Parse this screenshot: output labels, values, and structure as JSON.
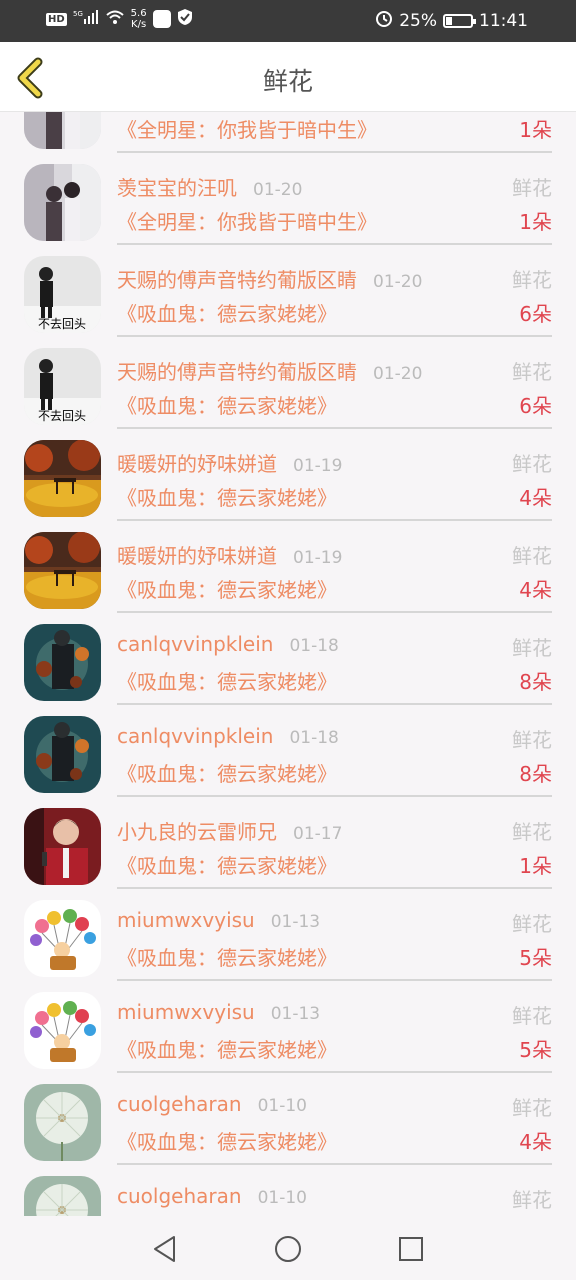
{
  "status": {
    "speed_top": "5.6",
    "speed_bottom": "K/s",
    "battery": "25%",
    "time": "11:41",
    "network": "5G"
  },
  "header": {
    "title": "鲜花"
  },
  "rows": [
    {
      "name": "",
      "date": "",
      "kind": "",
      "book": "《全明星：你我皆于暗中生》",
      "count": "1朵",
      "avatar": "couple"
    },
    {
      "name": "羡宝宝的汪叽",
      "date": "01-20",
      "kind": "鲜花",
      "book": "《全明星：你我皆于暗中生》",
      "count": "1朵",
      "avatar": "couple"
    },
    {
      "name": "天赐的傅声音特约葡版区睛",
      "date": "01-20",
      "kind": "鲜花",
      "book": "《吸血鬼：德云家姥姥》",
      "count": "6朵",
      "avatar": "bw",
      "avatar_text": "不去回头"
    },
    {
      "name": "天赐的傅声音特约葡版区睛",
      "date": "01-20",
      "kind": "鲜花",
      "book": "《吸血鬼：德云家姥姥》",
      "count": "6朵",
      "avatar": "bw",
      "avatar_text": "不去回头"
    },
    {
      "name": "暖暖妍的妤味姘道",
      "date": "01-19",
      "kind": "鲜花",
      "book": "《吸血鬼：德云家姥姥》",
      "count": "4朵",
      "avatar": "autumn"
    },
    {
      "name": "暖暖妍的妤味姘道",
      "date": "01-19",
      "kind": "鲜花",
      "book": "《吸血鬼：德云家姥姥》",
      "count": "4朵",
      "avatar": "autumn"
    },
    {
      "name": "canlqvvinpklein",
      "date": "01-18",
      "kind": "鲜花",
      "book": "《吸血鬼：德云家姥姥》",
      "count": "8朵",
      "avatar": "dark"
    },
    {
      "name": "canlqvvinpklein",
      "date": "01-18",
      "kind": "鲜花",
      "book": "《吸血鬼：德云家姥姥》",
      "count": "8朵",
      "avatar": "dark"
    },
    {
      "name": "小九良的云雷师兄",
      "date": "01-17",
      "kind": "鲜花",
      "book": "《吸血鬼：德云家姥姥》",
      "count": "1朵",
      "avatar": "red"
    },
    {
      "name": "miumwxvyisu",
      "date": "01-13",
      "kind": "鲜花",
      "book": "《吸血鬼：德云家姥姥》",
      "count": "5朵",
      "avatar": "balloon"
    },
    {
      "name": "miumwxvyisu",
      "date": "01-13",
      "kind": "鲜花",
      "book": "《吸血鬼：德云家姥姥》",
      "count": "5朵",
      "avatar": "balloon"
    },
    {
      "name": "cuolgeharan",
      "date": "01-10",
      "kind": "鲜花",
      "book": "《吸血鬼：德云家姥姥》",
      "count": "4朵",
      "avatar": "dandelion"
    },
    {
      "name": "cuolgeharan",
      "date": "01-10",
      "kind": "鲜花",
      "book": "",
      "count": "",
      "avatar": "dandelion"
    }
  ]
}
